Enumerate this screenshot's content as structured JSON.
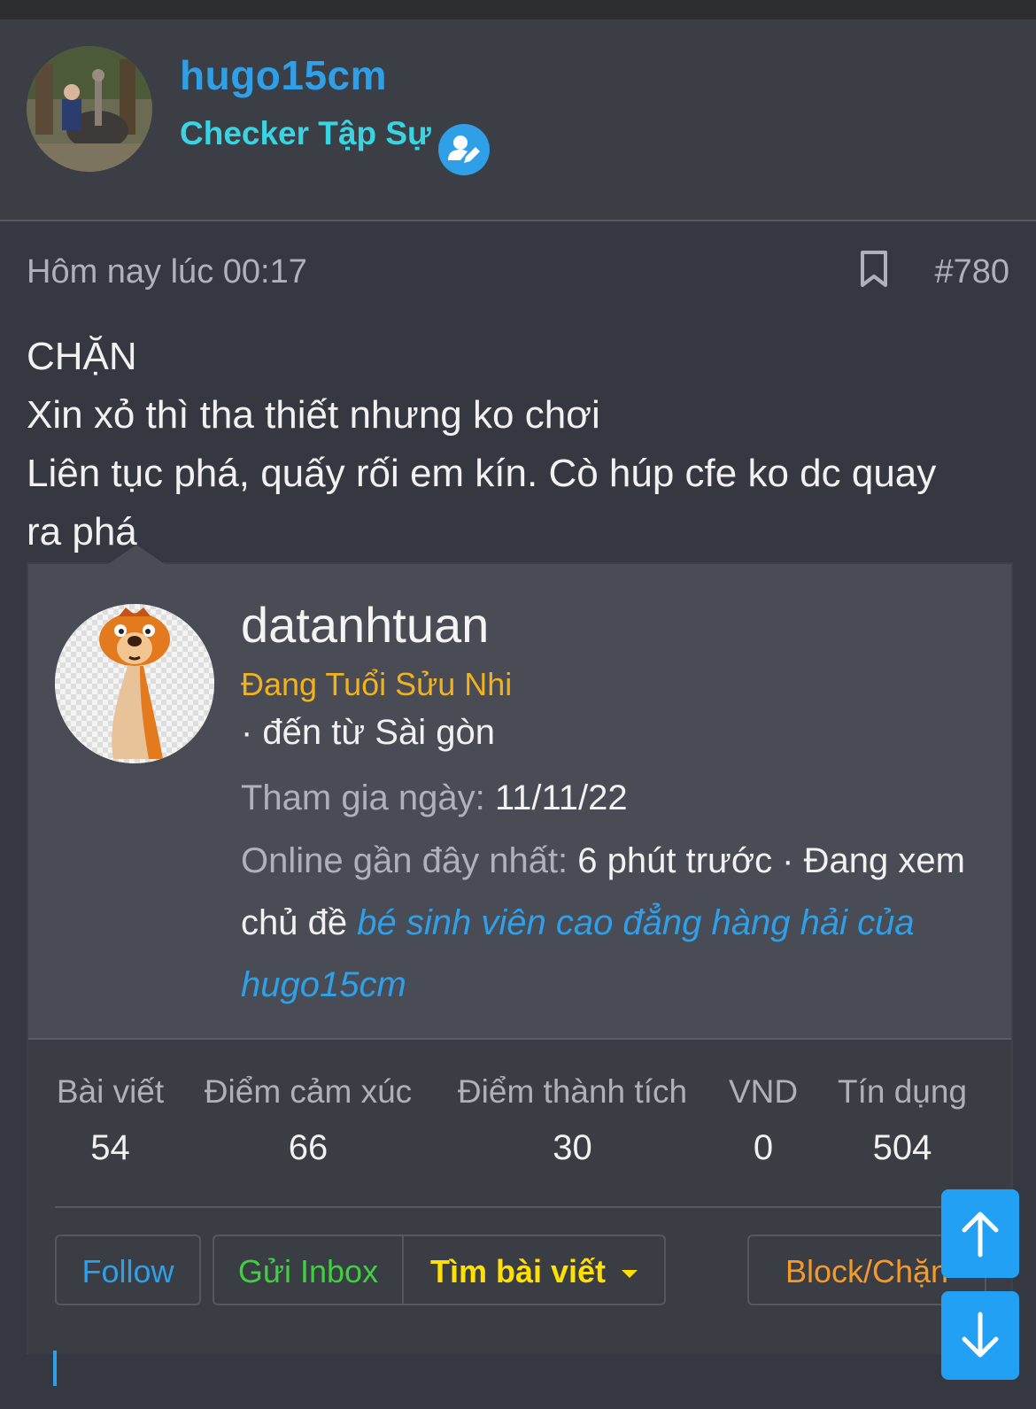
{
  "author": {
    "name": "hugo15cm",
    "title": "Checker Tập Sự",
    "verified_icon": "user-edit-icon"
  },
  "post": {
    "time": "Hôm nay lúc 00:17",
    "number": "#780",
    "bookmark_icon": "bookmark-icon",
    "lines": [
      "CHẶN",
      "Xin xỏ thì tha thiết nhưng ko chơi",
      "Liên tục phá, quấy rối em kín. Cò húp cfe ko dc quay",
      "ra phá"
    ]
  },
  "member_card": {
    "name": "datanhtuan",
    "rank": "Đang Tuổi Sửu Nhi",
    "location": "· đến từ Sài gòn",
    "joined_label": "Tham gia ngày:",
    "joined_value": "11/11/22",
    "online_label": "Online gần đây nhất:",
    "online_value": "6 phút trước · Đang xem chủ đề",
    "online_link": "bé sinh viên cao đẳng hàng hải của hugo15cm",
    "stats": [
      {
        "label": "Bài viết",
        "value": "54"
      },
      {
        "label": "Điểm cảm xúc",
        "value": "66"
      },
      {
        "label": "Điểm thành tích",
        "value": "30"
      },
      {
        "label": "VND",
        "value": "0"
      },
      {
        "label": "Tín dụng",
        "value": "504"
      }
    ],
    "buttons": {
      "follow": "Follow",
      "inbox": "Gửi Inbox",
      "find": "Tìm bài viết",
      "block": "Block/Chặn"
    }
  },
  "colors": {
    "accent": "#2f9fe8",
    "title_cyan": "#3ad3e2",
    "rank_gold": "#f0b21f",
    "inbox_green": "#3fd03f",
    "find_yellow": "#ffe000",
    "block_orange": "#f39a2b"
  }
}
